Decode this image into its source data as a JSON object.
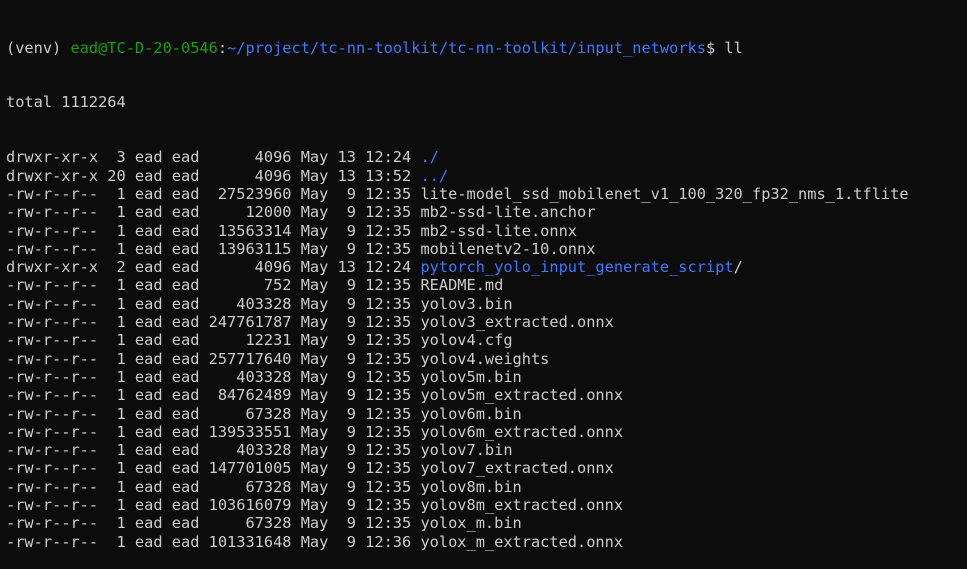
{
  "prompt": {
    "venv": "(venv) ",
    "user_host": "ead@TC-D-20-0546",
    "colon": ":",
    "path": "~/project/tc-nn-toolkit/tc-nn-toolkit/input_networks",
    "symbol": "$ ",
    "command": "ll"
  },
  "total_line": "total 1112264",
  "colors": {
    "background": "#0c0c0c",
    "foreground": "#cccccc",
    "prompt_user": "#13a10e",
    "directory": "#3b78ff"
  },
  "entries": [
    {
      "meta": "drwxr-xr-x  3 ead ead      4096 May 13 12:24 ",
      "name": "./",
      "is_dir": true
    },
    {
      "meta": "drwxr-xr-x 20 ead ead      4096 May 13 13:52 ",
      "name": "../",
      "is_dir": true
    },
    {
      "meta": "-rw-r--r--  1 ead ead  27523960 May  9 12:35 ",
      "name": "lite-model_ssd_mobilenet_v1_100_320_fp32_nms_1.tflite",
      "is_dir": false
    },
    {
      "meta": "-rw-r--r--  1 ead ead     12000 May  9 12:35 ",
      "name": "mb2-ssd-lite.anchor",
      "is_dir": false
    },
    {
      "meta": "-rw-r--r--  1 ead ead  13563314 May  9 12:35 ",
      "name": "mb2-ssd-lite.onnx",
      "is_dir": false
    },
    {
      "meta": "-rw-r--r--  1 ead ead  13963115 May  9 12:35 ",
      "name": "mobilenetv2-10.onnx",
      "is_dir": false
    },
    {
      "meta": "drwxr-xr-x  2 ead ead      4096 May 13 12:24 ",
      "name": "pytorch_yolo_input_generate_script",
      "suffix": "/",
      "is_dir": true
    },
    {
      "meta": "-rw-r--r--  1 ead ead       752 May  9 12:35 ",
      "name": "README.md",
      "is_dir": false
    },
    {
      "meta": "-rw-r--r--  1 ead ead    403328 May  9 12:35 ",
      "name": "yolov3.bin",
      "is_dir": false
    },
    {
      "meta": "-rw-r--r--  1 ead ead 247761787 May  9 12:35 ",
      "name": "yolov3_extracted.onnx",
      "is_dir": false
    },
    {
      "meta": "-rw-r--r--  1 ead ead     12231 May  9 12:35 ",
      "name": "yolov4.cfg",
      "is_dir": false
    },
    {
      "meta": "-rw-r--r--  1 ead ead 257717640 May  9 12:35 ",
      "name": "yolov4.weights",
      "is_dir": false
    },
    {
      "meta": "-rw-r--r--  1 ead ead    403328 May  9 12:35 ",
      "name": "yolov5m.bin",
      "is_dir": false
    },
    {
      "meta": "-rw-r--r--  1 ead ead  84762489 May  9 12:35 ",
      "name": "yolov5m_extracted.onnx",
      "is_dir": false
    },
    {
      "meta": "-rw-r--r--  1 ead ead     67328 May  9 12:35 ",
      "name": "yolov6m.bin",
      "is_dir": false
    },
    {
      "meta": "-rw-r--r--  1 ead ead 139533551 May  9 12:35 ",
      "name": "yolov6m_extracted.onnx",
      "is_dir": false
    },
    {
      "meta": "-rw-r--r--  1 ead ead    403328 May  9 12:35 ",
      "name": "yolov7.bin",
      "is_dir": false
    },
    {
      "meta": "-rw-r--r--  1 ead ead 147701005 May  9 12:35 ",
      "name": "yolov7_extracted.onnx",
      "is_dir": false
    },
    {
      "meta": "-rw-r--r--  1 ead ead     67328 May  9 12:35 ",
      "name": "yolov8m.bin",
      "is_dir": false
    },
    {
      "meta": "-rw-r--r--  1 ead ead 103616079 May  9 12:35 ",
      "name": "yolov8m_extracted.onnx",
      "is_dir": false
    },
    {
      "meta": "-rw-r--r--  1 ead ead     67328 May  9 12:35 ",
      "name": "yolox_m.bin",
      "is_dir": false
    },
    {
      "meta": "-rw-r--r--  1 ead ead 101331648 May  9 12:36 ",
      "name": "yolox_m_extracted.onnx",
      "is_dir": false
    }
  ]
}
